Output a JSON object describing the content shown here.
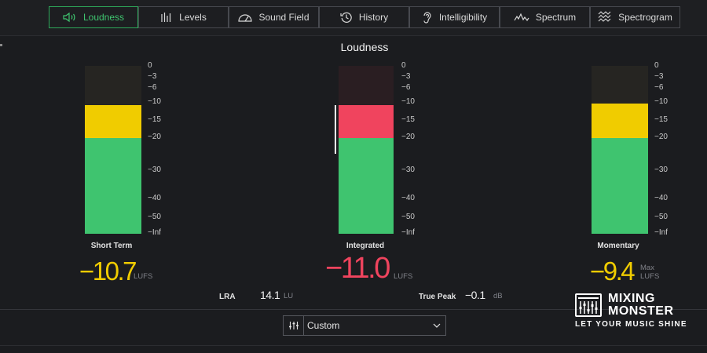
{
  "tabs": [
    {
      "label": "Loudness",
      "icon": "speaker-icon",
      "active": true
    },
    {
      "label": "Levels",
      "icon": "level-bars-icon",
      "active": false
    },
    {
      "label": "Sound Field",
      "icon": "sound-field-icon",
      "active": false
    },
    {
      "label": "History",
      "icon": "history-icon",
      "active": false
    },
    {
      "label": "Intelligibility",
      "icon": "ear-icon",
      "active": false
    },
    {
      "label": "Spectrum",
      "icon": "spectrum-icon",
      "active": false
    },
    {
      "label": "Spectrogram",
      "icon": "spectrogram-icon",
      "active": false
    }
  ],
  "panel": {
    "title": "Loudness"
  },
  "scale_labels": [
    "0",
    "−3",
    "−6",
    "−10",
    "−15",
    "−20",
    "−30",
    "−40",
    "−50",
    "−Inf"
  ],
  "meters": {
    "short_term": {
      "label": "Short Term",
      "value": "−10.7",
      "unit": "LUFS"
    },
    "integrated": {
      "label": "Integrated",
      "value": "−11.0",
      "unit": "LUFS"
    },
    "momentary": {
      "label": "Momentary",
      "value": "−9.4",
      "unit_line1": "Max",
      "unit_line2": "LUFS"
    }
  },
  "stats": {
    "lra": {
      "label": "LRA",
      "value": "14.1",
      "unit": "LU"
    },
    "true_peak": {
      "label": "True Peak",
      "value": "−0.1",
      "unit": "dB"
    }
  },
  "preset": {
    "value": "Custom"
  },
  "logo": {
    "line1": "MIXING",
    "line2": "MONSTER",
    "tagline": "LET YOUR MUSIC SHINE"
  },
  "colors": {
    "accent_green": "#3fc46f",
    "meter_green": "#3fc46f",
    "meter_yellow": "#f0cc00",
    "meter_red": "#f0445e",
    "meter_bg": "#26262a",
    "value_yellow": "#f0cc00",
    "value_red": "#f0445e"
  }
}
